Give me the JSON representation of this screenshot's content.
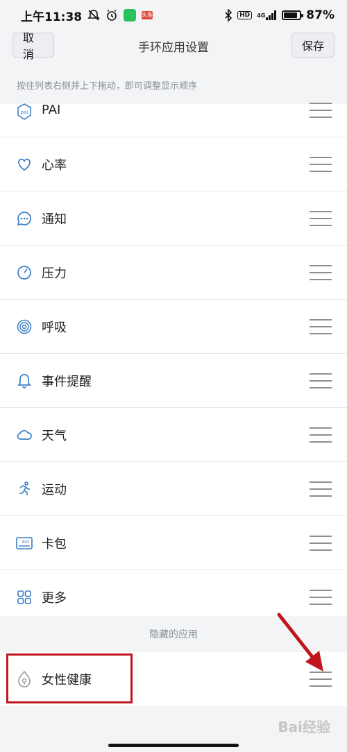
{
  "status_bar": {
    "time": "上午11:38",
    "network": "4G",
    "hd": "HD",
    "battery_text": "87%",
    "battery_level": 0.87,
    "notification_badge": "头条"
  },
  "nav": {
    "cancel_label": "取消",
    "title": "手环应用设置",
    "save_label": "保存"
  },
  "hint_text": "按住列表右侧并上下拖动，即可调整显示顺序",
  "apps": [
    {
      "label": "PAI",
      "icon": "pai-icon"
    },
    {
      "label": "心率",
      "icon": "heart-icon"
    },
    {
      "label": "通知",
      "icon": "chat-bubble-icon"
    },
    {
      "label": "压力",
      "icon": "gauge-icon"
    },
    {
      "label": "呼吸",
      "icon": "breath-rings-icon"
    },
    {
      "label": "事件提醒",
      "icon": "bell-icon"
    },
    {
      "label": "天气",
      "icon": "cloud-icon"
    },
    {
      "label": "运动",
      "icon": "running-icon"
    },
    {
      "label": "卡包",
      "icon": "bus-card-icon"
    },
    {
      "label": "更多",
      "icon": "grid-icon"
    }
  ],
  "hidden_section": {
    "header": "隐藏的应用",
    "items": [
      {
        "label": "女性健康",
        "icon": "female-health-icon"
      }
    ]
  },
  "watermark": "Bai经验",
  "colors": {
    "accent_icon": "#3a7fc4",
    "highlight_border": "#c0151d",
    "arrow": "#c0151d"
  }
}
